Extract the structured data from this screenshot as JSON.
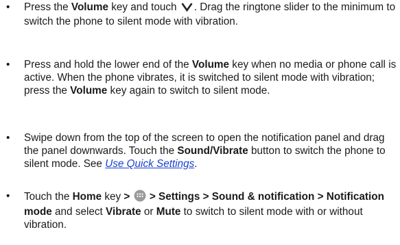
{
  "bullet_glyph": "•",
  "items": [
    {
      "a1": "Press the ",
      "b1": "Volume",
      "a2": " key and touch ",
      "icon": "chevron-down-icon",
      "a3": ". Drag the ringtone slider to the minimum to switch the phone to silent mode with vibration."
    },
    {
      "a1": "Press and hold the lower end of the ",
      "b1": "Volume",
      "a2": " key when no media or phone call is active. When the phone vibrates, it is switched to silent mode with vibration; press the ",
      "b2": "Volume",
      "a3": " key again to switch to silent mode."
    },
    {
      "a1": "Swipe down from the top of the screen to open the notification panel and drag the panel downwards. Touch the ",
      "b1": "Sound/Vibrate",
      "a2": " button to switch the phone to silent mode. See ",
      "link": "Use Quick Settings",
      "a3": "."
    },
    {
      "a1": "Touch the ",
      "b1": "Home",
      "a2": " key ",
      "b2": ">",
      "icon": "apps-icon",
      "b3": "> Settings > Sound & notification > Notification mode",
      "a3": " and select ",
      "b4": "Vibrate",
      "a4": " or ",
      "b5": "Mute",
      "a5": " to switch to silent mode with or without vibration."
    }
  ],
  "icon_color": "#9a9a9a"
}
